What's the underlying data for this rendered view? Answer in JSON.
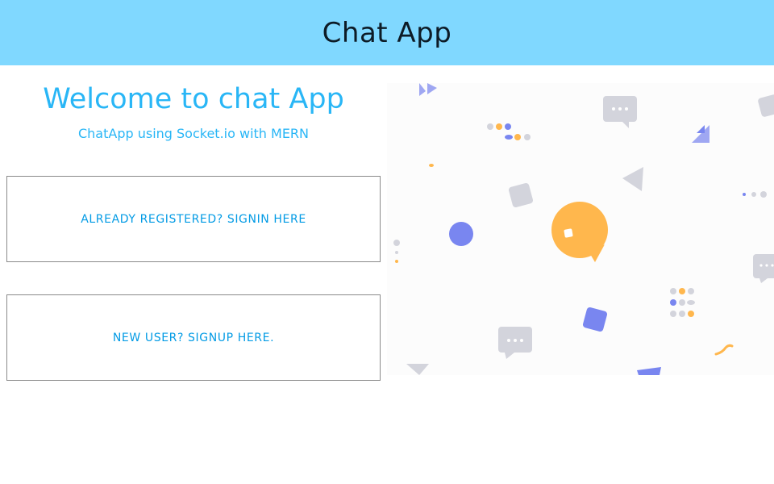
{
  "header": {
    "title": "Chat App"
  },
  "hero": {
    "heading": "Welcome to chat App",
    "subheading": "ChatApp using Socket.io with MERN"
  },
  "actions": {
    "signin_label": "ALREADY REGISTERED? SIGNIN HERE",
    "signup_label": "NEW USER? SIGNUP HERE."
  },
  "illustration": {
    "icon": "chat-bubbles-confetti-illustration",
    "colors": {
      "yellow": "#ffb74d",
      "purple": "#7986f0",
      "gray": "#d3d4dc"
    }
  },
  "colors": {
    "header_bg": "#80d8ff",
    "accent": "#29b6f6",
    "button_text": "#039be5",
    "button_border": "#8a8a8a"
  }
}
